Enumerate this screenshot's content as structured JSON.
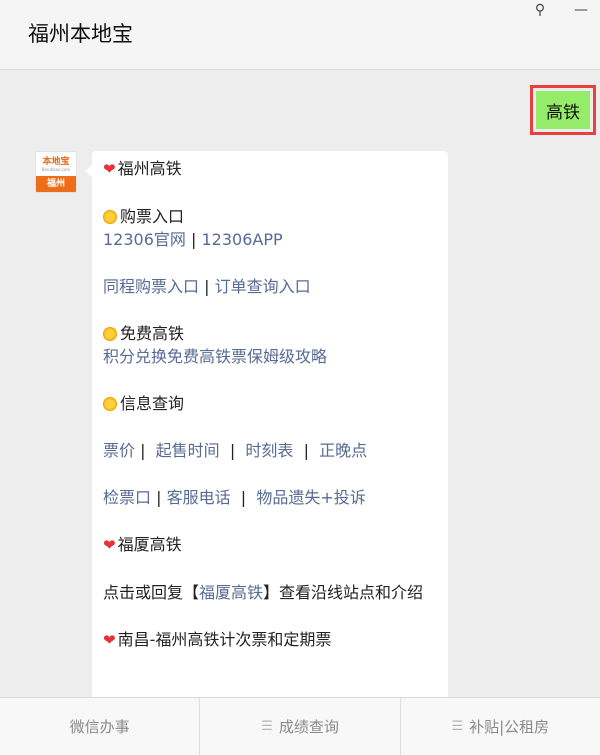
{
  "window": {
    "title": "福州本地宝",
    "pin_icon": "pin-icon",
    "pin_glyph": "⚲",
    "minimize_icon": "minimize-icon",
    "minimize_glyph": "—"
  },
  "user_message": {
    "text": "高铁",
    "highlight_color": "#e8403f",
    "bubble_color": "#95ec69"
  },
  "avatar": {
    "logo_text": "本地宝",
    "logo_sub": "Bendibao.com",
    "city": "福州"
  },
  "reply": {
    "title": "福州高铁",
    "buy": {
      "heading": "购票入口",
      "link1": "12306官网",
      "sep1": "|",
      "link2": "12306APP",
      "link3": "同程购票入口",
      "sep2": "|",
      "link4": "订单查询入口"
    },
    "free": {
      "heading": "免费高铁",
      "link": "积分兑换免费高铁票保姆级攻略"
    },
    "info": {
      "heading": "信息查询",
      "row1": [
        "票价",
        "起售时间",
        "时刻表",
        "正晚点"
      ],
      "row2": [
        "检票口",
        "客服电话",
        "物品遗失+投诉"
      ],
      "sep": "|"
    },
    "fuxia": {
      "heading": "福厦高铁",
      "text_before": "点击或回复【",
      "link": "福厦高铁",
      "text_after": "】查看沿线站点和介绍"
    },
    "nanchang": {
      "heading": "南昌-福州高铁计次票和定期票"
    },
    "link_color": "#576b95"
  },
  "bottom_menu": {
    "items": [
      {
        "label": "微信办事",
        "has_menu_icon": false
      },
      {
        "label": "成绩查询",
        "has_menu_icon": true
      },
      {
        "label": "补贴|公租房",
        "has_menu_icon": true
      }
    ],
    "menu_icon": "menu-lines-icon",
    "menu_glyph": "☰"
  }
}
